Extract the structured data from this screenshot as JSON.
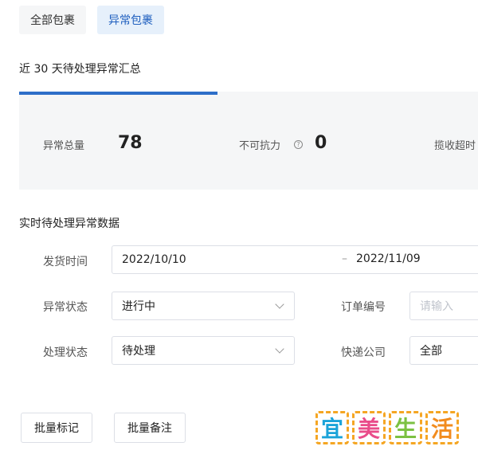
{
  "tabs": [
    {
      "label": "全部包裹",
      "active": false
    },
    {
      "label": "异常包裹",
      "active": true
    }
  ],
  "summary": {
    "title": "近 30 天待处理异常汇总",
    "cards": [
      {
        "label": "异常总量",
        "value": "78"
      },
      {
        "label": "不可抗力",
        "value": "0",
        "icon": "info-icon"
      },
      {
        "label": "揽收超时"
      }
    ]
  },
  "realtime": {
    "title": "实时待处理异常数据"
  },
  "filters": {
    "ship_time": {
      "label": "发货时间",
      "start": "2022/10/10",
      "separator": "–",
      "end": "2022/11/09"
    },
    "exception_status": {
      "label": "异常状态",
      "value": "进行中"
    },
    "order_no": {
      "label": "订单编号",
      "placeholder": "请输入"
    },
    "process_status": {
      "label": "处理状态",
      "value": "待处理"
    },
    "courier": {
      "label": "快递公司",
      "value": "全部"
    }
  },
  "actions": {
    "batch_mark": "批量标记",
    "batch_remark": "批量备注"
  },
  "watermark": {
    "chars": [
      "宜",
      "美",
      "生",
      "活"
    ],
    "colors": [
      "#1aa3d9",
      "#e94c8a",
      "#7cc142",
      "#f28c1e"
    ],
    "border_color": "#f5a623"
  }
}
